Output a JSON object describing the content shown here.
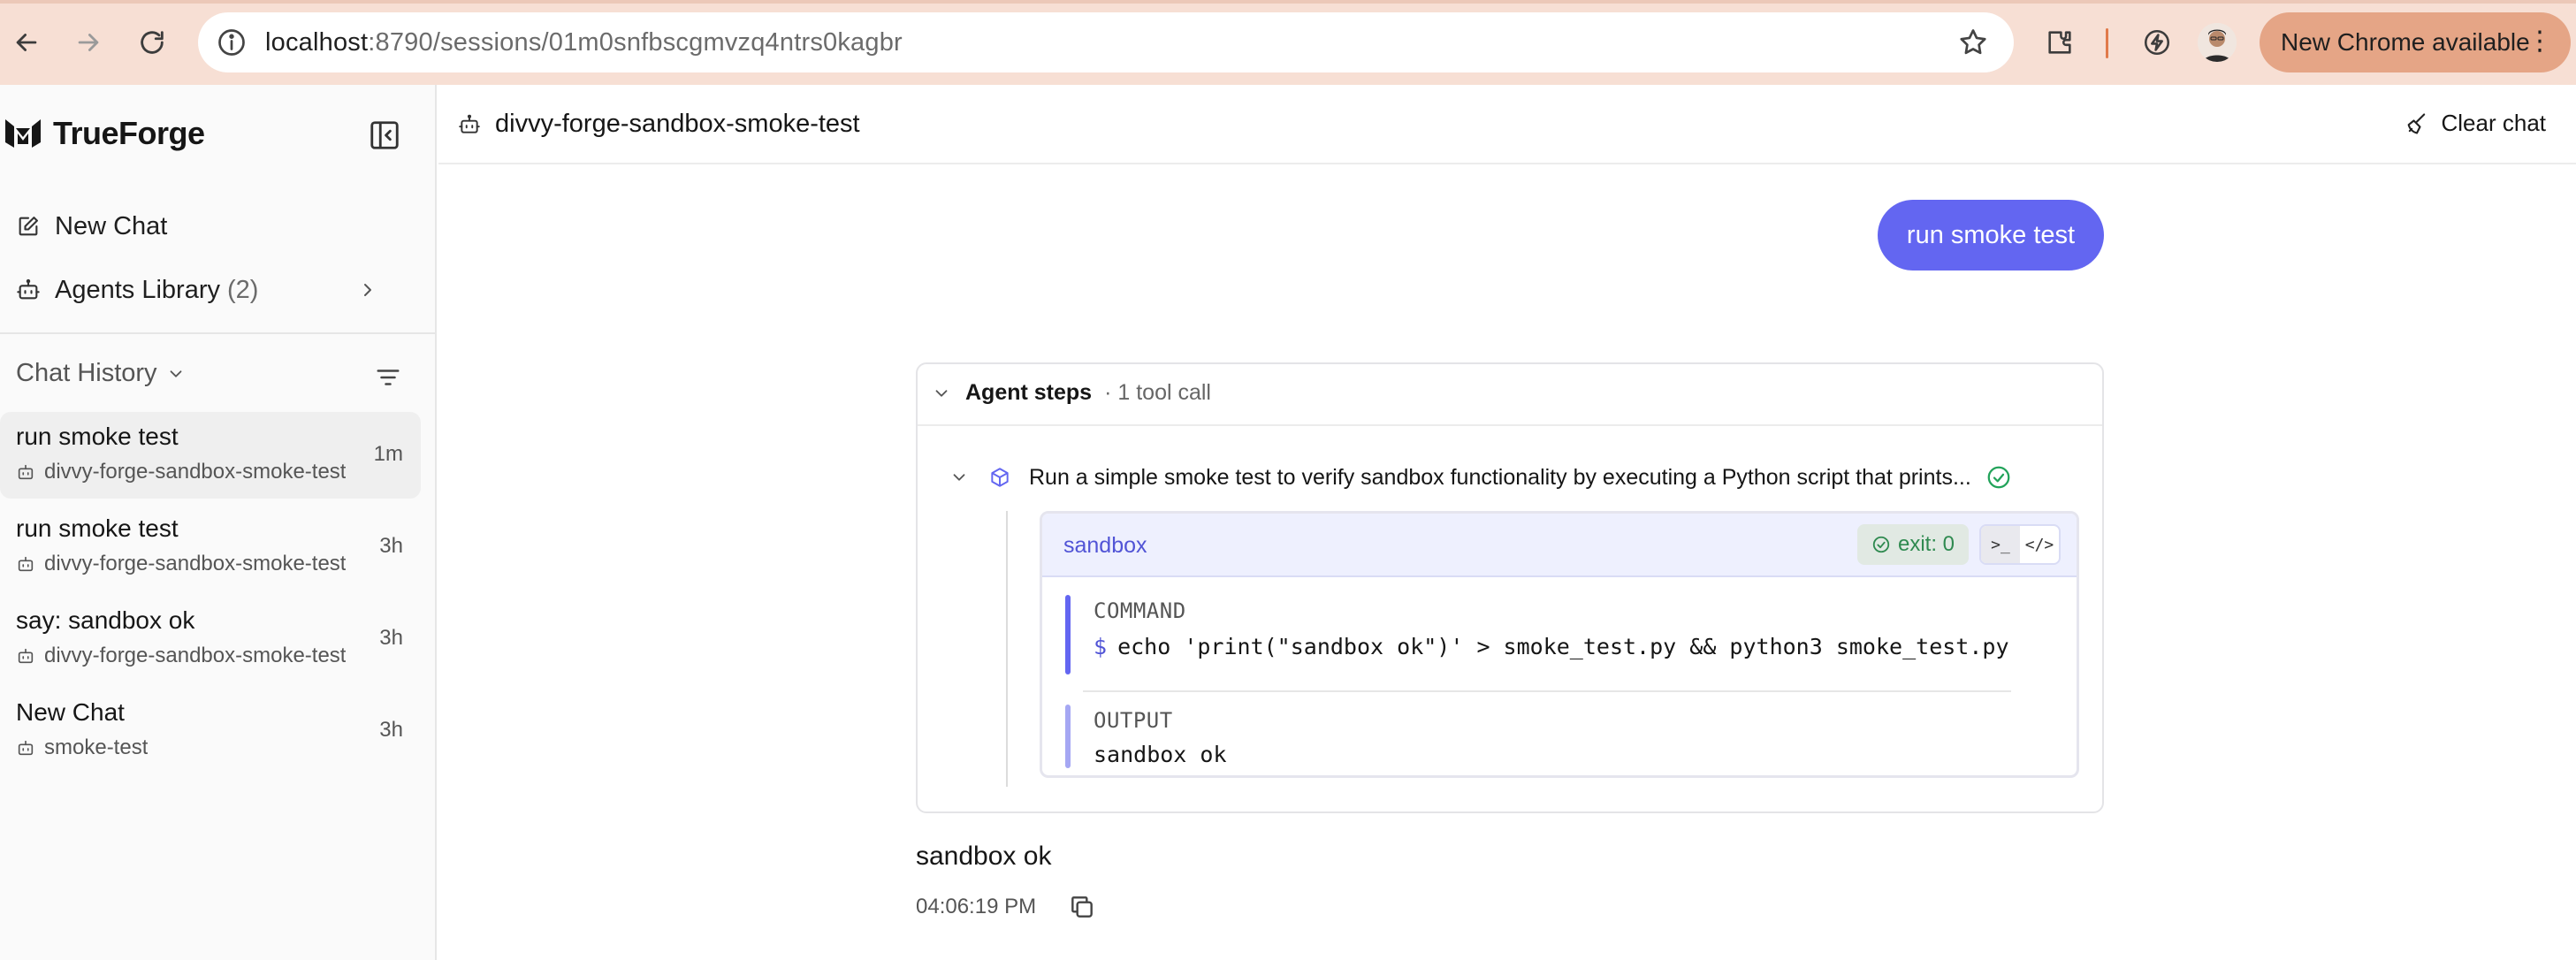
{
  "browser": {
    "url_host": "localhost",
    "url_path": ":8790/sessions/01m0snfbscgmvzq4ntrs0kagbr",
    "update_label": "New Chrome available",
    "icons": [
      "back-arrow-icon",
      "forward-arrow-icon",
      "reload-icon",
      "site-info-icon",
      "bookmark-star-icon",
      "extensions-icon",
      "performance-icon",
      "profile-avatar",
      "kebab-menu-icon"
    ]
  },
  "sidebar": {
    "brand": "TrueForge",
    "nav": {
      "new_chat": "New Chat",
      "agents_library": "Agents Library",
      "agents_count": "(2)"
    },
    "history_label": "Chat History",
    "chats": [
      {
        "title": "run smoke test",
        "agent": "divvy-forge-sandbox-smoke-test",
        "time": "1m",
        "active": true
      },
      {
        "title": "run smoke test",
        "agent": "divvy-forge-sandbox-smoke-test",
        "time": "3h",
        "active": false
      },
      {
        "title": "say: sandbox ok",
        "agent": "divvy-forge-sandbox-smoke-test",
        "time": "3h",
        "active": false
      },
      {
        "title": "New Chat",
        "agent": "smoke-test",
        "time": "3h",
        "active": false
      }
    ]
  },
  "header": {
    "agent_name": "divvy-forge-sandbox-smoke-test",
    "clear_label": "Clear chat"
  },
  "conversation": {
    "user_message": "run smoke test",
    "steps": {
      "label": "Agent steps",
      "meta": "· 1 tool call",
      "tool_description": "Run a simple smoke test to verify sandbox functionality by executing a Python script that prints...",
      "sandbox": {
        "name": "sandbox",
        "exit": "exit: 0",
        "toggle_terminal": ">_",
        "toggle_code": "</>",
        "command_label": "COMMAND",
        "prompt": "$",
        "command": "echo 'print(\"sandbox ok\")' > smoke_test.py && python3 smoke_test.py",
        "output_label": "OUTPUT",
        "output": "sandbox ok"
      }
    },
    "assistant_message": "sandbox ok",
    "timestamp": "04:06:19 PM"
  },
  "colors": {
    "accent": "#6366f1",
    "chrome_bg": "#f7dfd4",
    "update_pill": "#e5a586",
    "success": "#22a35a"
  }
}
